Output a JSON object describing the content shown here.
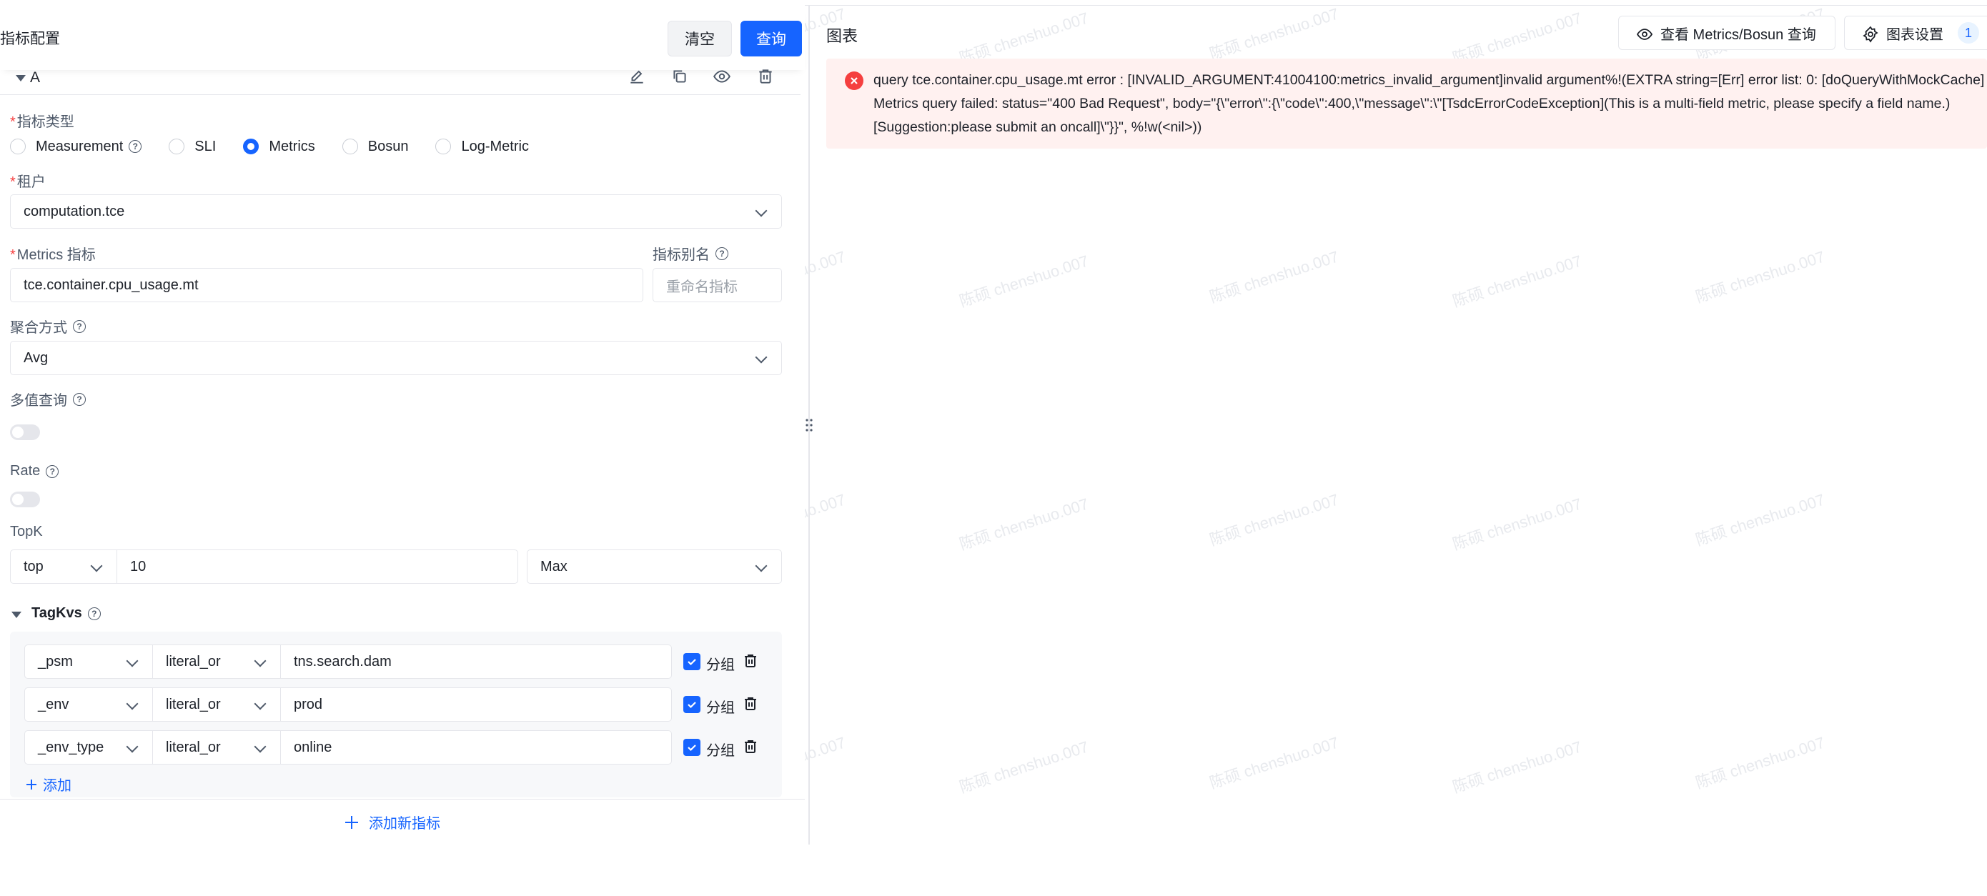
{
  "left": {
    "title": "指标配置",
    "clear_label": "清空",
    "query_label": "查询",
    "section_name": "A",
    "metric_type_label": "指标类型",
    "metric_types": [
      "Measurement",
      "SLI",
      "Metrics",
      "Bosun",
      "Log-Metric"
    ],
    "selected_metric_type": "Metrics",
    "tenant_label": "租户",
    "tenant_value": "computation.tce",
    "metric_label": "Metrics 指标",
    "metric_value": "tce.container.cpu_usage.mt",
    "alias_label": "指标别名",
    "alias_placeholder": "重命名指标",
    "agg_label": "聚合方式",
    "agg_value": "Avg",
    "multi_label": "多值查询",
    "rate_label": "Rate",
    "topk_label": "TopK",
    "topk_mode": "top",
    "topk_value": "10",
    "topk_func": "Max",
    "tagkvs_label": "TagKvs",
    "tags": [
      {
        "key": "_psm",
        "op": "literal_or",
        "value": "tns.search.dam",
        "group_label": "分组"
      },
      {
        "key": "_env",
        "op": "literal_or",
        "value": "prod",
        "group_label": "分组"
      },
      {
        "key": "_env_type",
        "op": "literal_or",
        "value": "online",
        "group_label": "分组"
      }
    ],
    "add_label": "添加",
    "add_metric_label": "添加新指标"
  },
  "right": {
    "title": "图表",
    "view_query_label": "查看 Metrics/Bosun 查询",
    "chart_settings_label": "图表设置",
    "settings_badge": "1",
    "error_lines": [
      "query tce.container.cpu_usage.mt error : [INVALID_ARGUMENT:41004100:metrics_invalid_argument]invalid argument%!(EXTRA string=[Err] error list: 0: [doQueryWithMockCache]",
      "Metrics query failed: status=\"400 Bad Request\", body=\"{\\\"error\\\":{\\\"code\\\":400,\\\"message\\\":\\\"[TsdcErrorCodeException](This is a multi-field metric, please specify a field name.)",
      "[Suggestion:please submit an oncall]\\\"}}\", %!w(<nil>))"
    ]
  },
  "watermark_text": "陈硕 chenshuo.007",
  "colors": {
    "primary": "#1664ff",
    "error_bg": "#fff1f0",
    "error_icon": "#f53f3f"
  }
}
